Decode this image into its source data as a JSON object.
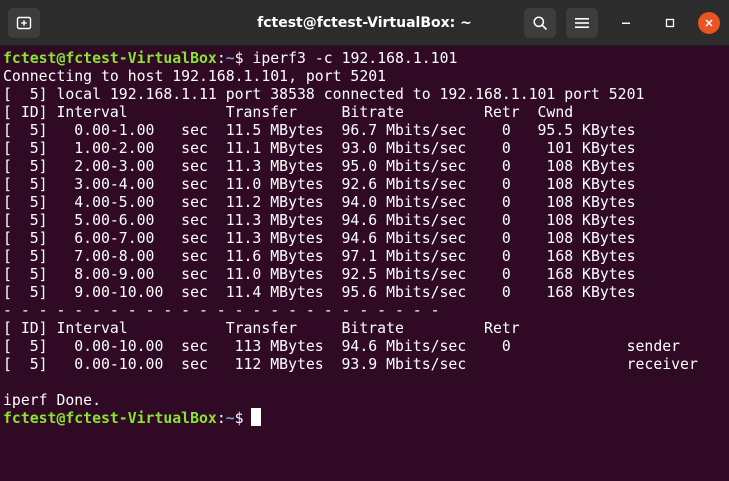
{
  "window": {
    "title": "fctest@fctest-VirtualBox: ~",
    "buttons": {
      "new_tab": "new-tab-icon",
      "search": "search-icon",
      "menu": "hamburger-menu-icon",
      "minimize": "minimize-icon",
      "maximize": "maximize-icon",
      "close": "close-icon"
    },
    "colors": {
      "titlebar": "#2c2c2c",
      "terminal_bg": "#300a24",
      "prompt_user": "#8ae234",
      "prompt_path": "#729fcf",
      "close_button": "#e95420",
      "text": "#ffffff"
    }
  },
  "terminal": {
    "prompt": {
      "user_host": "fctest@fctest-VirtualBox",
      "colon": ":",
      "path": "~",
      "symbol": "$"
    },
    "command": " iperf3 -c 192.168.1.101",
    "output": [
      "Connecting to host 192.168.1.101, port 5201",
      "[  5] local 192.168.1.11 port 38538 connected to 192.168.1.101 port 5201",
      "[ ID] Interval           Transfer     Bitrate         Retr  Cwnd",
      "[  5]   0.00-1.00   sec  11.5 MBytes  96.7 Mbits/sec    0   95.5 KBytes",
      "[  5]   1.00-2.00   sec  11.1 MBytes  93.0 Mbits/sec    0    101 KBytes",
      "[  5]   2.00-3.00   sec  11.3 MBytes  95.0 Mbits/sec    0    108 KBytes",
      "[  5]   3.00-4.00   sec  11.0 MBytes  92.6 Mbits/sec    0    108 KBytes",
      "[  5]   4.00-5.00   sec  11.2 MBytes  94.0 Mbits/sec    0    108 KBytes",
      "[  5]   5.00-6.00   sec  11.3 MBytes  94.6 Mbits/sec    0    108 KBytes",
      "[  5]   6.00-7.00   sec  11.3 MBytes  94.6 Mbits/sec    0    108 KBytes",
      "[  5]   7.00-8.00   sec  11.6 MBytes  97.1 Mbits/sec    0    168 KBytes",
      "[  5]   8.00-9.00   sec  11.0 MBytes  92.5 Mbits/sec    0    168 KBytes",
      "[  5]   9.00-10.00  sec  11.4 MBytes  95.6 Mbits/sec    0    168 KBytes",
      "- - - - - - - - - - - - - - - - - - - - - - - - -",
      "[ ID] Interval           Transfer     Bitrate         Retr",
      "[  5]   0.00-10.00  sec   113 MBytes  94.6 Mbits/sec    0             sender",
      "[  5]   0.00-10.00  sec   112 MBytes  93.9 Mbits/sec                  receiver",
      "",
      "iperf Done."
    ]
  }
}
